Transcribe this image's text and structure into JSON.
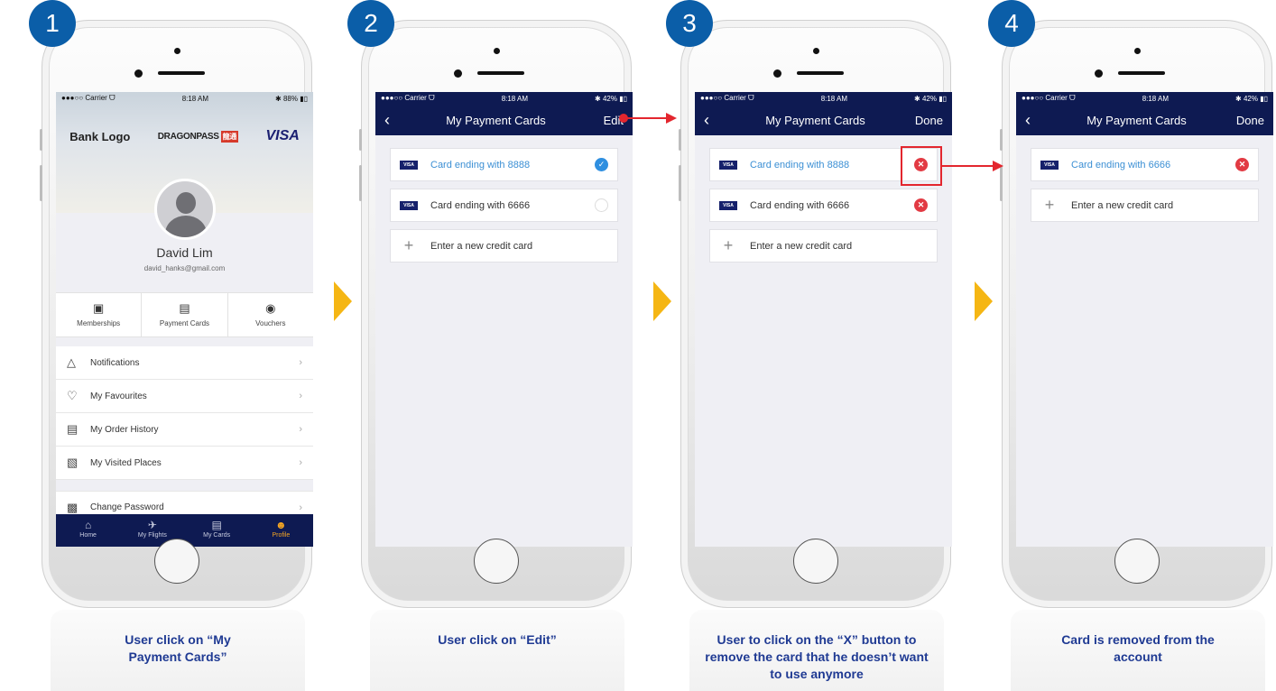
{
  "steps": [
    {
      "number": "1",
      "caption": "User click on “My Payment Cards”",
      "status": {
        "signal": "●●●○○ Carrier ᗜ",
        "time": "8:18 AM",
        "battery": "✱ 88% ▮▯"
      },
      "profile": {
        "logos": {
          "bank": "Bank Logo",
          "dragonpass": "DRAGONPASS",
          "dragonpass_mark": "龍通",
          "visa": "VISA"
        },
        "name": "David Lim",
        "email": "david_hanks@gmail.com",
        "tiles": [
          {
            "label": "Memberships",
            "icon": "membership-card-icon"
          },
          {
            "label": "Payment Cards",
            "icon": "credit-card-icon"
          },
          {
            "label": "Vouchers",
            "icon": "voucher-icon"
          }
        ],
        "menu": [
          {
            "label": "Notifications",
            "icon": "bell-icon"
          },
          {
            "label": "My Favourites",
            "icon": "heart-icon"
          },
          {
            "label": "My Order History",
            "icon": "clipboard-icon"
          },
          {
            "label": "My Visited Places",
            "icon": "visited-places-icon"
          }
        ],
        "change_password": {
          "label": "Change Password",
          "icon": "lock-icon"
        },
        "tabbar": [
          {
            "label": "Home",
            "icon": "home-icon"
          },
          {
            "label": "My Flights",
            "icon": "airplane-icon"
          },
          {
            "label": "My Cards",
            "icon": "card-icon"
          },
          {
            "label": "Profile",
            "icon": "person-icon",
            "active": true
          }
        ]
      }
    },
    {
      "number": "2",
      "caption": "User click on “Edit”",
      "status": {
        "signal": "●●●○○ Carrier ᗜ",
        "time": "8:18 AM",
        "battery": "✱ 42% ▮▯"
      },
      "nav": {
        "back": "‹",
        "title": "My Payment Cards",
        "action": "Edit"
      },
      "cards": [
        {
          "label": "Card ending with 8888",
          "state": "selected"
        },
        {
          "label": "Card ending with 6666",
          "state": "unselected"
        }
      ],
      "add_card": "Enter a new credit card"
    },
    {
      "number": "3",
      "caption": "User to click on the “X” button to remove the card that he doesn’t want to use anymore",
      "status": {
        "signal": "●●●○○ Carrier ᗜ",
        "time": "8:18 AM",
        "battery": "✱ 42% ▮▯"
      },
      "nav": {
        "back": "‹",
        "title": "My Payment Cards",
        "action": "Done"
      },
      "cards": [
        {
          "label": "Card ending with 8888",
          "state": "removable",
          "highlight": true
        },
        {
          "label": "Card ending with 6666",
          "state": "removable"
        }
      ],
      "add_card": "Enter a new credit card"
    },
    {
      "number": "4",
      "caption": "Card is removed from the account",
      "status": {
        "signal": "●●●○○ Carrier ᗜ",
        "time": "8:18 AM",
        "battery": "✱ 42% ▮▯"
      },
      "nav": {
        "back": "‹",
        "title": "My Payment Cards",
        "action": "Done"
      },
      "cards": [
        {
          "label": "Card ending with 6666",
          "state": "removable"
        }
      ],
      "add_card": "Enter a new credit card"
    }
  ],
  "glyphs": {
    "visa_badge": "VISA",
    "check": "✓",
    "remove": "✕",
    "plus": "+",
    "chevron": "›"
  },
  "colors": {
    "navbar": "#0e1a52",
    "badge": "#0b5ea8",
    "step_arrow": "#f5b614",
    "remove": "#e23a43",
    "selected": "#2f8fe0",
    "annotation": "#e3262e",
    "caption": "#1f3a93"
  }
}
